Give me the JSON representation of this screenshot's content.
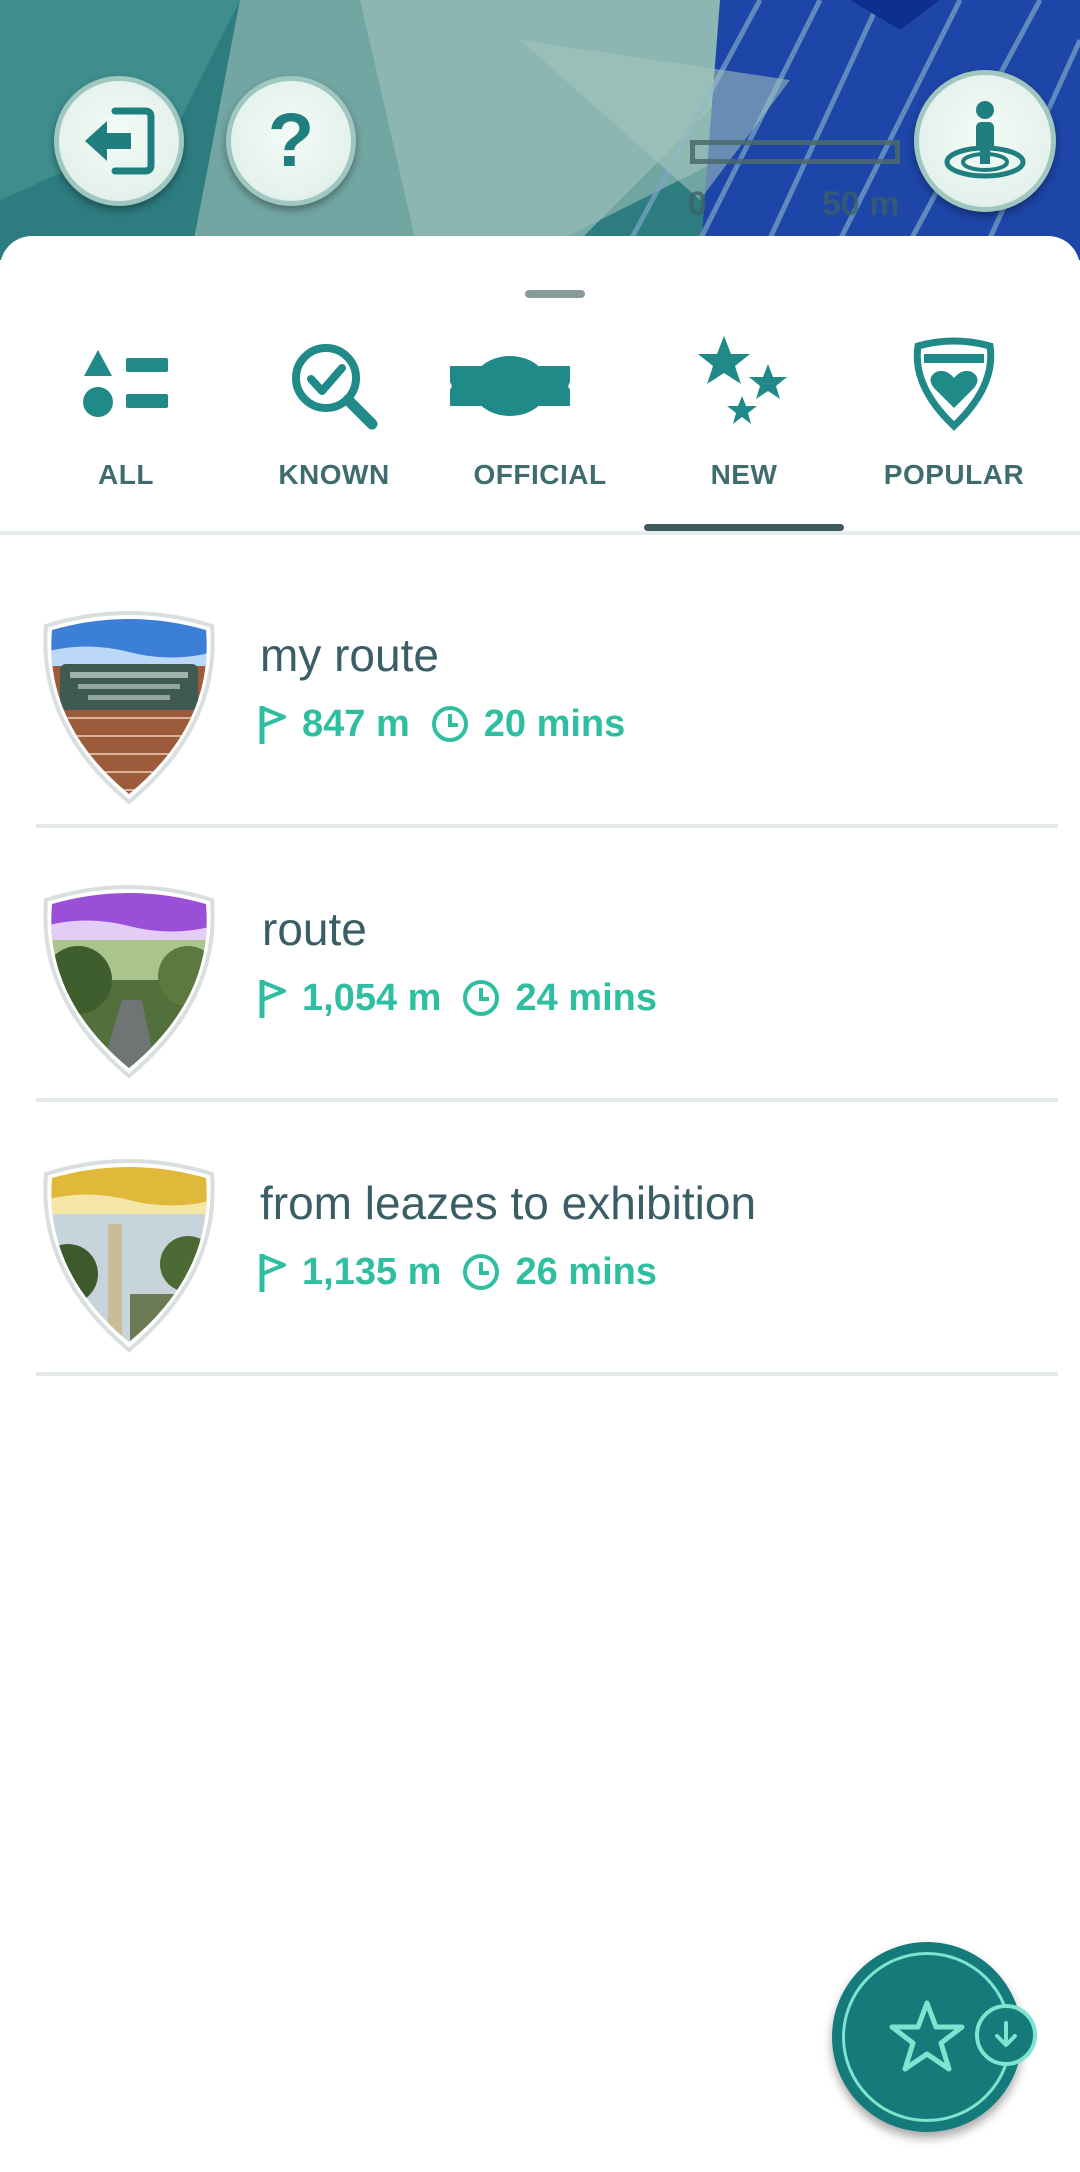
{
  "map": {
    "scale_start": "0",
    "scale_end": "50 m",
    "exit_icon": "exit-door-icon",
    "help_icon": "question-icon",
    "location_icon": "player-location-icon"
  },
  "tabs": [
    {
      "label": "ALL",
      "icon": "shapes-list-icon",
      "selected": false
    },
    {
      "label": "KNOWN",
      "icon": "magnifier-check-icon",
      "selected": false
    },
    {
      "label": "OFFICIAL",
      "icon": "ribbon-badge-icon",
      "selected": false
    },
    {
      "label": "NEW",
      "icon": "stars-icon",
      "selected": true
    },
    {
      "label": "POPULAR",
      "icon": "shield-heart-icon",
      "selected": false
    }
  ],
  "routes": [
    {
      "name": "my route",
      "distance": "847 m",
      "duration": "20 mins",
      "badge_color": "#3c7fd6"
    },
    {
      "name": "route",
      "distance": "1,054 m",
      "duration": "24 mins",
      "badge_color": "#9a4fd8"
    },
    {
      "name": "from leazes to exhibition",
      "distance": "1,135 m",
      "duration": "26 mins",
      "badge_color": "#e0b93b"
    }
  ],
  "colors": {
    "teal": "#157a7a",
    "accent_green": "#2fbfa0",
    "label": "#3f6d6f"
  },
  "fab": {
    "icon": "star-icon",
    "badge_icon": "download-arrow-icon"
  }
}
